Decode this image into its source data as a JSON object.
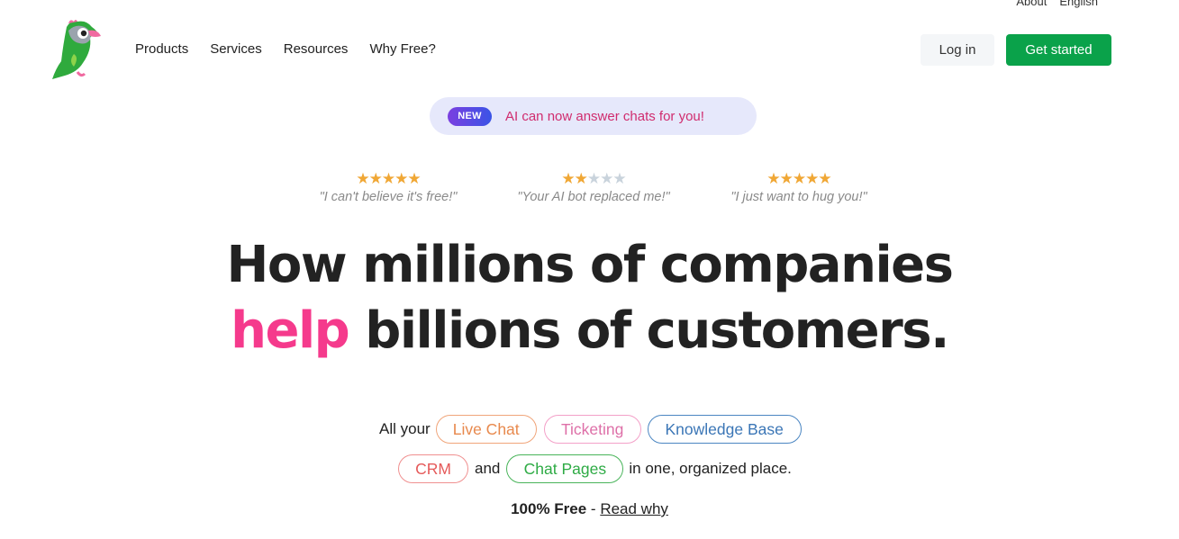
{
  "top_links": {
    "about": "About",
    "language": "English"
  },
  "nav": {
    "items": [
      "Products",
      "Services",
      "Resources",
      "Why Free?"
    ]
  },
  "auth": {
    "login": "Log in",
    "get_started": "Get started"
  },
  "announcement": {
    "badge": "NEW",
    "text": "AI can now answer chats for you!"
  },
  "reviews": [
    {
      "stars": 5,
      "quote": "\"I can't believe it's free!\""
    },
    {
      "stars": 2,
      "quote": "\"Your AI bot replaced me!\""
    },
    {
      "stars": 5,
      "quote": "\"I just want to hug you!\""
    }
  ],
  "headline": {
    "line1": "How millions of companies",
    "highlight": "help",
    "line2_rest": " billions of customers."
  },
  "products": {
    "prefix": "All your",
    "live_chat": "Live Chat",
    "ticketing": "Ticketing",
    "knowledge_base": "Knowledge Base",
    "crm": "CRM",
    "and": "and",
    "chat_pages": "Chat Pages",
    "suffix": "in one, organized place."
  },
  "free": {
    "bold": "100% Free",
    "sep": " - ",
    "link": "Read why"
  },
  "colors": {
    "brand_green": "#0aa24a",
    "highlight_pink": "#f53a8c",
    "star": "#f0a735"
  }
}
